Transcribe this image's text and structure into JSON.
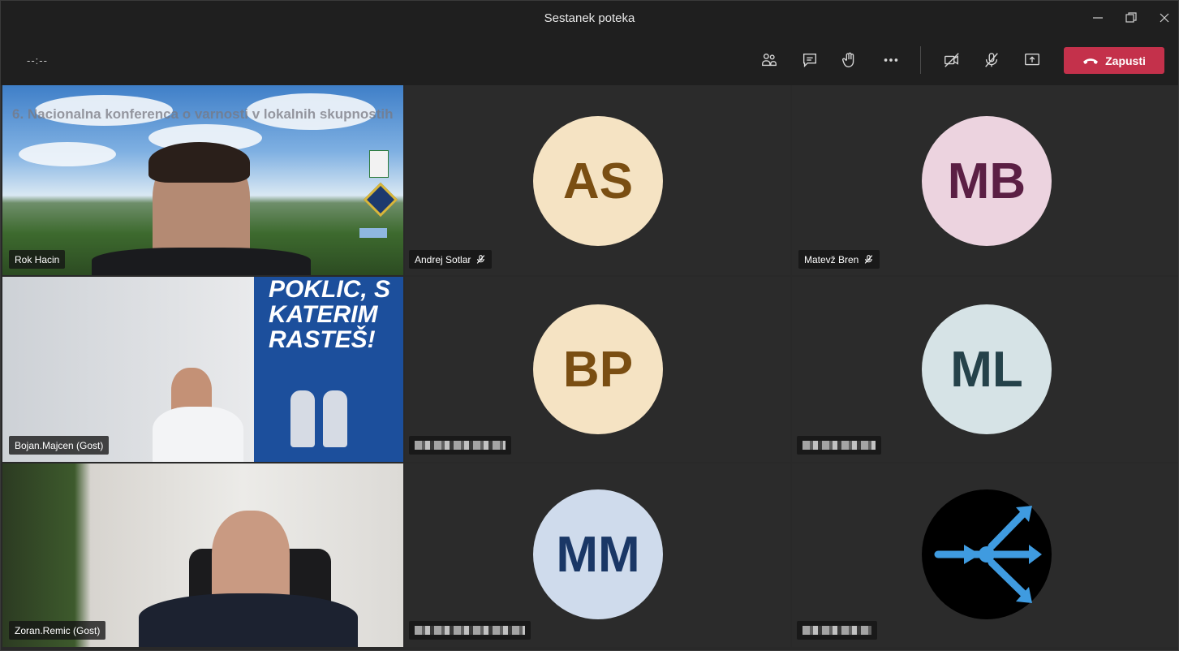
{
  "window": {
    "title": "Sestanek poteka"
  },
  "toolbar": {
    "timer": "--:--",
    "leave_label": "Zapusti",
    "icons": [
      "participants-icon",
      "chat-icon",
      "raise-hand-icon",
      "more-icon",
      "camera-off-icon",
      "mic-off-icon",
      "share-screen-icon",
      "hangup-icon"
    ],
    "leave_color": "#c4314b"
  },
  "tiles": {
    "rok": {
      "name": "Rok Hacin",
      "slide_title": "6. Nacionalna konferenca o varnosti v lokalnih skupnostih"
    },
    "andrej": {
      "name": "Andrej Sotlar",
      "initials": "AS",
      "bg": "#f5e3c3",
      "fg": "#7a4e12"
    },
    "matevz": {
      "name": "Matevž Bren",
      "initials": "MB",
      "bg": "#ecd3df",
      "fg": "#5b1f44"
    },
    "bojan": {
      "name": "Bojan.Majcen (Gost)",
      "poster_text": "POKLIC, S KATERIM RASTEŠ!"
    },
    "bp": {
      "initials": "BP",
      "bg": "#f5e3c3",
      "fg": "#7a4e12"
    },
    "ml": {
      "initials": "ML",
      "bg": "#d6e3e6",
      "fg": "#25424a"
    },
    "zoran": {
      "name": "Zoran.Remic (Gost)"
    },
    "mm": {
      "initials": "MM",
      "bg": "#cfdbec",
      "fg": "#1a3766"
    },
    "bot": {
      "icon": "connector-icon"
    }
  }
}
